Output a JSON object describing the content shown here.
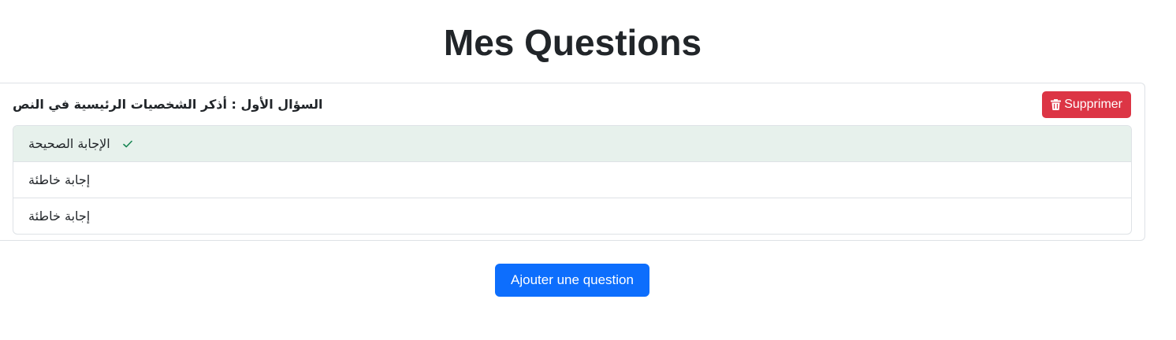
{
  "page": {
    "title": "Mes Questions"
  },
  "question": {
    "text": "السؤال الأول : أذكر الشخصيات الرئيسية في النص",
    "delete_label": "Supprimer",
    "delete_icon": "trash-icon",
    "answers": [
      {
        "text": "الإجابة الصحيحة",
        "correct": true,
        "icon": "check-icon"
      },
      {
        "text": "إجابة خاطئة",
        "correct": false
      },
      {
        "text": "إجابة خاطئة",
        "correct": false
      }
    ]
  },
  "actions": {
    "add_label": "Ajouter une question"
  },
  "colors": {
    "danger": "#dc3545",
    "primary": "#0d6efd",
    "success": "#198754",
    "correct_bg": "#e7f1ec"
  }
}
